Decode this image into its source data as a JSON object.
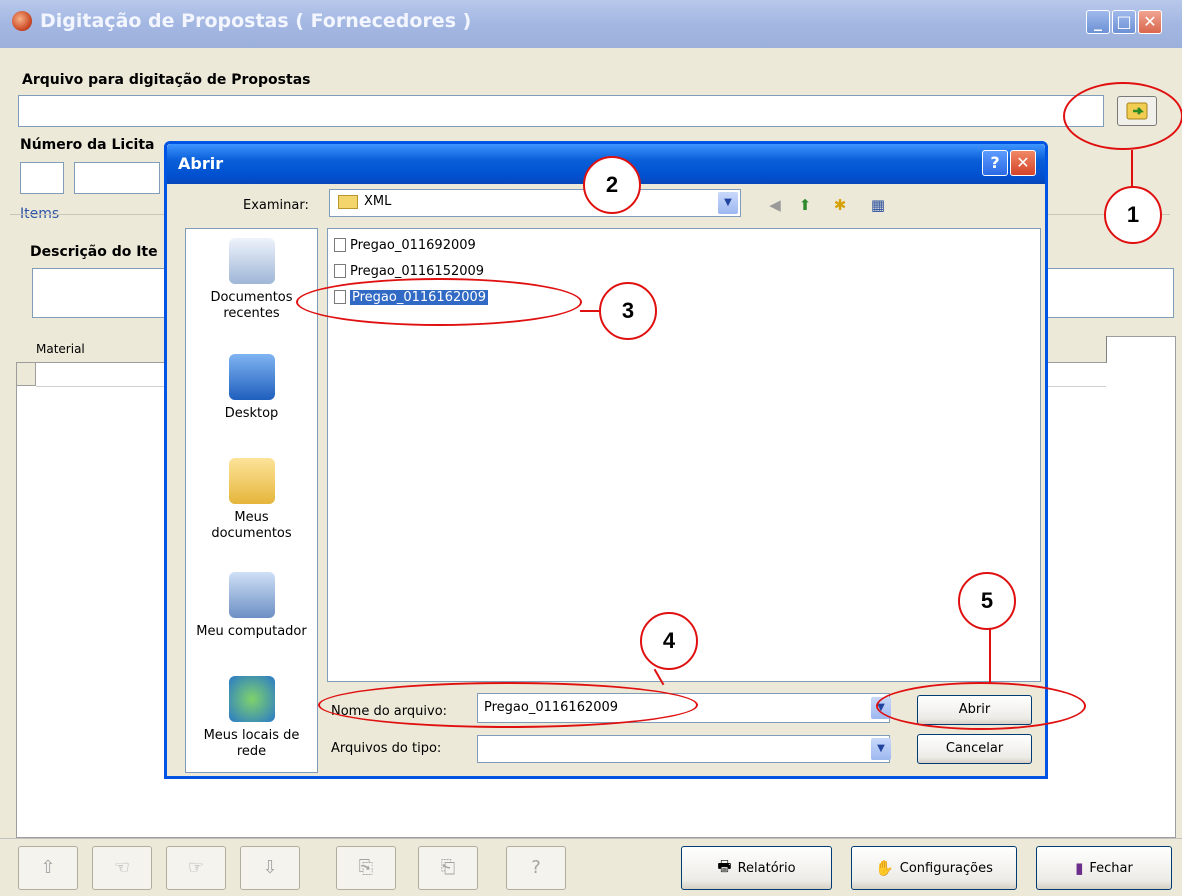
{
  "main": {
    "title": "Digitação de Propostas ( Fornecedores )",
    "file_label": "Arquivo para digitação de Propostas",
    "bid_label": "Número da Licita",
    "items_tab": "Items",
    "item_desc_label": "Descrição do Ite",
    "grid_col_material": "Material"
  },
  "dialog": {
    "title": "Abrir",
    "look_in_label": "Examinar:",
    "look_in_value": "XML",
    "places": [
      "Documentos recentes",
      "Desktop",
      "Meus documentos",
      "Meu computador",
      "Meus locais de rede"
    ],
    "files": [
      "Pregao_011692009",
      "Pregao_0116152009",
      "Pregao_0116162009"
    ],
    "filename_label": "Nome do arquivo:",
    "filename_value": "Pregao_0116162009",
    "filetype_label": "Arquivos do tipo:",
    "open_button": "Abrir",
    "cancel_button": "Cancelar"
  },
  "toolbar": {
    "report_button": "Relatório",
    "settings_button": "Configurações",
    "close_button": "Fechar"
  },
  "annotations": [
    "1",
    "2",
    "3",
    "4",
    "5"
  ],
  "colors": {
    "annotation": "#e01010",
    "dialog_title": "#0054e3",
    "selection": "#316ac5"
  }
}
